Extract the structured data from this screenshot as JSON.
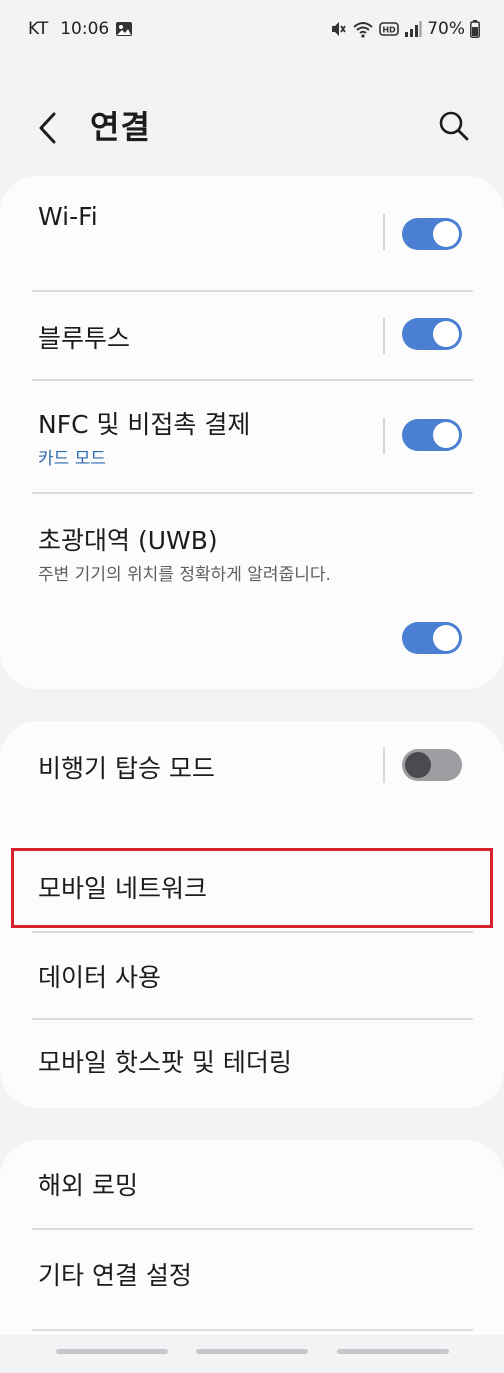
{
  "status_bar": {
    "carrier": "KT",
    "time": "10:06",
    "battery": "70%"
  },
  "header": {
    "title": "연결"
  },
  "group1": [
    {
      "title": "Wi-Fi",
      "enabled": true
    },
    {
      "title": "블루투스",
      "enabled": true
    },
    {
      "title": "NFC 및 비접촉 결제",
      "subtitle": "카드 모드",
      "enabled": true
    },
    {
      "title": "초광대역 (UWB)",
      "subtitle": "주변 기기의 위치를 정확하게 알려줍니다.",
      "enabled": true
    }
  ],
  "group2": [
    {
      "title": "비행기 탑승 모드",
      "enabled": false
    },
    {
      "title": "모바일 네트워크"
    },
    {
      "title": "데이터 사용"
    },
    {
      "title": "모바일 핫스팟 및 테더링"
    }
  ],
  "group3": [
    {
      "title": "해외 로밍"
    },
    {
      "title": "기타 연결 설정"
    }
  ],
  "colors": {
    "accent": "#4a7fd2",
    "subtitle_blue": "#2e69ae",
    "highlight": "#d8232f"
  }
}
